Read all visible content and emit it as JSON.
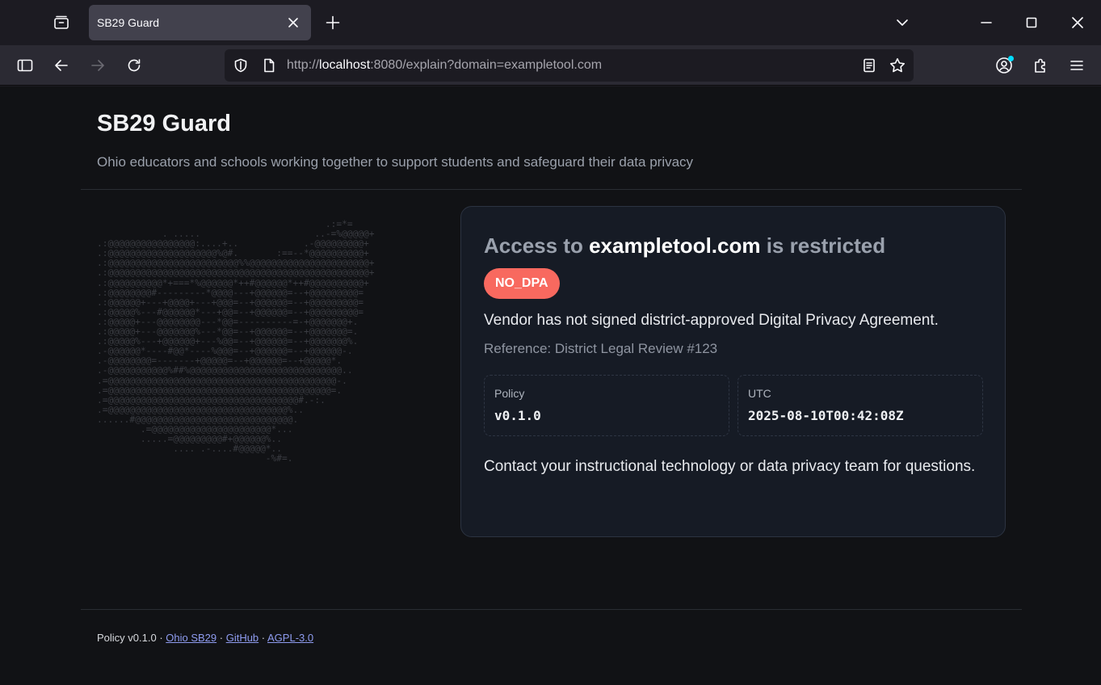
{
  "browser": {
    "tab_title": "SB29 Guard",
    "url_prefix": "http://",
    "url_host": "localhost",
    "url_rest": ":8080/explain?domain=exampletool.com",
    "icons": [
      "tab-list-icon",
      "close-icon",
      "plus-icon",
      "chevron-down-icon",
      "minimize-icon",
      "maximize-icon",
      "window-close-icon",
      "sidebar-icon",
      "back-icon",
      "forward-icon",
      "reload-icon",
      "shield-icon",
      "page-icon",
      "reader-view-icon",
      "star-icon",
      "account-icon",
      "extensions-icon",
      "menu-icon"
    ]
  },
  "header": {
    "title": "SB29 Guard",
    "subtitle": "Ohio educators and schools working together to support students and safeguard their data privacy"
  },
  "ascii_art": [
    "                                          .:=*=",
    "            . .....                     ..-=%@@@@@+",
    ".:@@@@@@@@@@@@@@@@:....+..            .-@@@@@@@@@+",
    ".:@@@@@@@@@@@@@@@@@@@@%@#.       :==--*@@@@@@@@@@+",
    ".:@@@@@@@@@@@@@@@@@@@@@@@@%%@@@@@@@@@@@@@@@@@@@@@@+",
    ".:@@@@@@@@@@@@@@@@@@@@@@@@@@@@@@@@@@@@@@@@@@@@@@@@+",
    ".:@@@@@@@@@@*+===*%@@@@@@*++#@@@@@@*++#@@@@@@@@@@+",
    ".:@@@@@@@@#---------*@@@@---+@@@@@@=--+@@@@@@@@@=",
    ".:@@@@@@+---+@@@@+---+@@@=--+@@@@@@=--+@@@@@@@@@=",
    ".:@@@@@%---#@@@@@@*---+@@=--+@@@@@@=--+@@@@@@@@@=",
    ".:@@@@@+---@@@@@@@@---*@@=----------=-+@@@@@@@+.",
    ".:@@@@@+---@@@@@@@%---*@@=--+@@@@@@=--+@@@@@@@=.",
    ".:@@@@@%---+@@@@@@+---%@@=--+@@@@@@=--+@@@@@@@%.",
    ".-@@@@@@*----#@@*----%@@@=--+@@@@@@=--+@@@@@@-.",
    ".-@@@@@@@@=-------+@@@@@=--+@@@@@@=--+@@@@@*.",
    ".-@@@@@@@@@@@%##%@@@@@@@@@@@@@@@@@@@@@@@@@@@@..",
    ".=@@@@@@@@@@@@@@@@@@@@@@@@@@@@@@@@@@@@@@@@@@-.",
    ".=@@@@@@@@@@@@@@@@@@@@@@@@@@@@@@@@@@@@@@@@@=.",
    ".=@@@@@@@@@@@@@@@@@@@@@@@@@@@@@@@@@@@#.-:.",
    ".=@@@@@@@@@@@@@@@@@@@@@@@@@@@@@@@@@%..",
    "......#@@@@@@@@@@@@@@@@@@@@@@@@@@@@@.",
    "        .=@@@@@@@@@@@@@@@@@@@@@@*...",
    "        .....=@@@@@@@@@#+@@@@@@%..",
    "              .... .-....#@@@@@*..",
    "                               -%#=."
  ],
  "card": {
    "heading_prefix": "Access to ",
    "domain": "exampletool.com",
    "heading_suffix": " is restricted",
    "badge": "NO_DPA",
    "reason": "Vendor has not signed district-approved Digital Privacy Agreement.",
    "reference": "Reference: District Legal Review #123",
    "meta": [
      {
        "label": "Policy",
        "value": "v0.1.0"
      },
      {
        "label": "UTC",
        "value": "2025-08-10T00:42:08Z"
      }
    ],
    "contact": "Contact your instructional technology or data privacy team for questions."
  },
  "footer": {
    "policy_text": "Policy v0.1.0 · ",
    "sep": " · ",
    "links": [
      "Ohio SB29",
      "GitHub",
      "AGPL-3.0"
    ]
  },
  "colors": {
    "badge": "#f8695f",
    "link": "#8f9cf0",
    "card_bg": "#161b25",
    "page_bg": "#111215"
  }
}
